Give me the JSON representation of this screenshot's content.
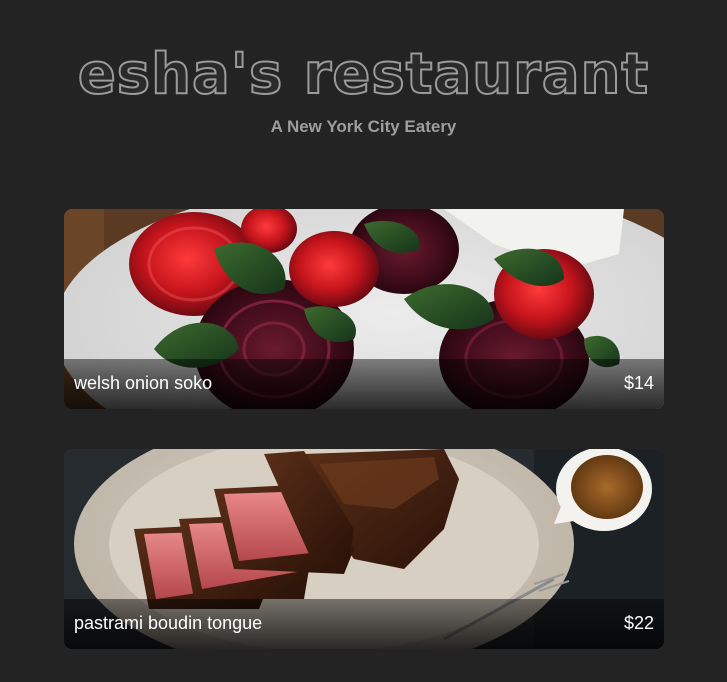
{
  "header": {
    "title": "esha's restaurant",
    "subtitle": "A New York City Eatery"
  },
  "menu": {
    "items": [
      {
        "name": "welsh onion soko",
        "price": "$14",
        "image": "roasted-beets-greens-photo"
      },
      {
        "name": "pastrami boudin tongue",
        "price": "$22",
        "image": "sliced-steak-sauce-photo"
      }
    ]
  },
  "colors": {
    "background": "#232323",
    "title_outline": "#9a9a9a",
    "subtitle": "#9d9d9d",
    "caption_text": "#ffffff"
  }
}
